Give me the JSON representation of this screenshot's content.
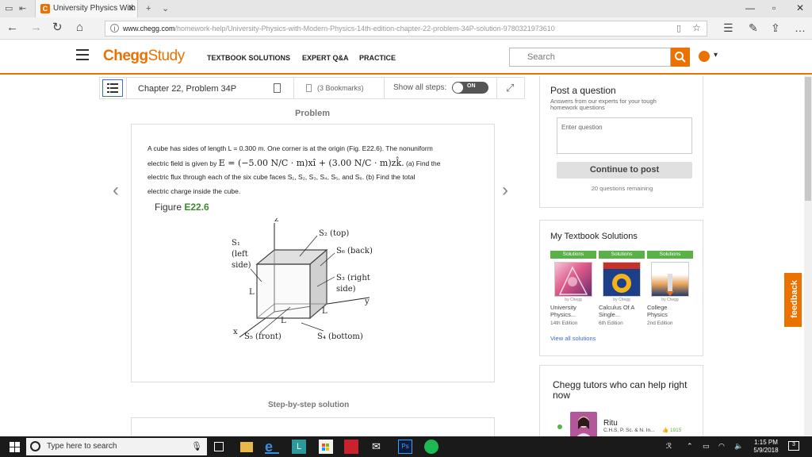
{
  "browser": {
    "tab_title": "University Physics With",
    "tab_favicon": "C",
    "url_host": "www.chegg.com",
    "url_path": "/homework-help/University-Physics-with-Modern-Physics-14th-edition-chapter-22-problem-34P-solution-9780321973610"
  },
  "header": {
    "logo_main": "Chegg",
    "logo_sub": "Study",
    "nav": [
      "TEXTBOOK SOLUTIONS",
      "EXPERT Q&A",
      "PRACTICE"
    ],
    "search_placeholder": "Search"
  },
  "toolbar": {
    "chapter_title": "Chapter 22, Problem 34P",
    "bookmarks": "(3 Bookmarks)",
    "show_all": "Show all steps:",
    "toggle": "ON"
  },
  "problem": {
    "label": "Problem",
    "line1": "A cube has sides of length L = 0.300 m. One corner is at the origin (Fig. E22.6). The nonuniform",
    "line2_pre": "electric field is given by",
    "line2_eq": "E = (−5.00 N/C · m)xî + (3.00 N/C · m)zk̂.",
    "line2_post": "(a) Find the",
    "line3": "electric flux through each of the six cube faces S₁, S₂, S₃, S₄, S₅, and S₆. (b) Find the total",
    "line4": "electric charge inside the cube.",
    "figure_word": "Figure",
    "figure_num": "E22.6",
    "fig_labels": {
      "z": "z",
      "s2": "S₂ (top)",
      "s6": "S₆ (back)",
      "s1a": "S₁",
      "s1b": "(left",
      "s1c": "side)",
      "s3a": "S₃ (right",
      "s3b": "side)",
      "y": "y",
      "L": "L",
      "x": "x",
      "s5": "S₅ (front)",
      "s4": "S₄ (bottom)"
    }
  },
  "steps": {
    "label": "Step-by-step solution"
  },
  "post": {
    "title": "Post a question",
    "subtitle": "Answers from our experts for your tough homework questions",
    "placeholder": "Enter question",
    "button": "Continue to post",
    "remaining": "20 questions remaining"
  },
  "textbooks": {
    "title": "My Textbook Solutions",
    "tag": "Solutions",
    "brand": "by Chegg",
    "books": [
      {
        "name1": "University",
        "name2": "Physics...",
        "edition": "14th Edition"
      },
      {
        "name1": "Calculus Of A",
        "name2": "Single...",
        "edition": "6th Edition"
      },
      {
        "name1": "College",
        "name2": "Physics",
        "edition": "2nd Edition"
      }
    ],
    "view_all": "View all solutions"
  },
  "tutors": {
    "title": "Chegg tutors who can help right now",
    "name": "Ritu",
    "creds": "C.H.S, P. Sc. & N. In...",
    "score": "1915"
  },
  "feedback": "feedback",
  "taskbar": {
    "search_placeholder": "Type here to search",
    "time": "1:15 PM",
    "date": "5/9/2018",
    "notifications": "3"
  },
  "colors": {
    "chegg_orange": "#eb7100",
    "solutions_green": "#5ab148",
    "link_blue": "#3b6ad9"
  }
}
